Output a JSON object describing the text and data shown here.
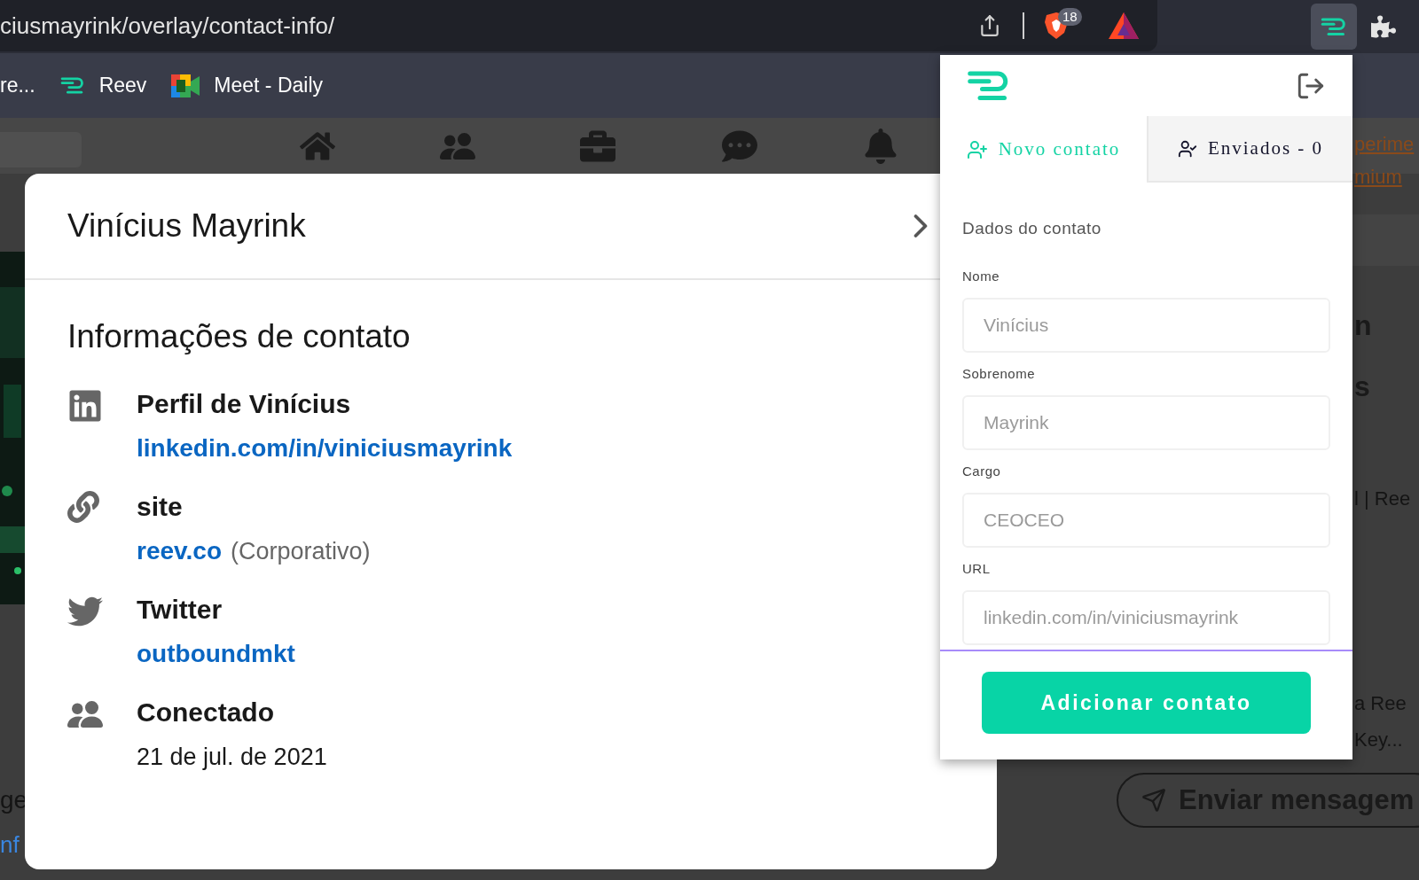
{
  "browser": {
    "address": "ciusmayrink/overlay/contact-info/",
    "shields_badge": "18",
    "extensions": [
      {
        "kind": "reev",
        "selected": true
      },
      {
        "kind": "puzzle",
        "selected": false
      }
    ],
    "bookmarks": [
      {
        "kind": "plain",
        "label": "re..."
      },
      {
        "kind": "reev",
        "label": "Reev"
      },
      {
        "kind": "meet",
        "label": "Meet - Daily"
      }
    ]
  },
  "background_page": {
    "right_fragments": [
      {
        "kind": "link",
        "text": "perime"
      },
      {
        "kind": "link",
        "text": "mium"
      },
      {
        "kind": "heading",
        "text": "n"
      },
      {
        "kind": "heading",
        "text": "s"
      },
      {
        "kind": "text",
        "text": "l | Ree"
      },
      {
        "kind": "text",
        "text": "a Ree"
      },
      {
        "kind": "text",
        "text": "Key..."
      }
    ],
    "left_fragments": [
      {
        "kind": "text",
        "text": "ge"
      },
      {
        "kind": "link",
        "text": "nf"
      }
    ],
    "message_button": "Enviar mensagem"
  },
  "modal": {
    "title": "Vinícius Mayrink",
    "heading": "Informações de contato",
    "sections": [
      {
        "kind": "linkedin",
        "title": "Perfil de Vinícius",
        "link": "linkedin.com/in/viniciusmayrink"
      },
      {
        "kind": "site",
        "title": "site",
        "link": "reev.co",
        "note": "(Corporativo)"
      },
      {
        "kind": "twitter",
        "title": "Twitter",
        "link": "outboundmkt"
      },
      {
        "kind": "connected",
        "title": "Conectado",
        "text": "21 de jul. de 2021"
      }
    ]
  },
  "popup": {
    "tabs": [
      {
        "kind": "add",
        "label": "Novo contato",
        "selected": true
      },
      {
        "kind": "sent",
        "label": "Enviados - 0",
        "selected": false
      }
    ],
    "section_title": "Dados do contato",
    "fields": [
      {
        "label": "Nome",
        "value": "Vinícius"
      },
      {
        "label": "Sobrenome",
        "value": "Mayrink"
      },
      {
        "label": "Cargo",
        "value": "CEOCEO"
      },
      {
        "label": "URL",
        "value": "linkedin.com/in/viniciusmayrink"
      }
    ],
    "submit": "Adicionar contato"
  }
}
